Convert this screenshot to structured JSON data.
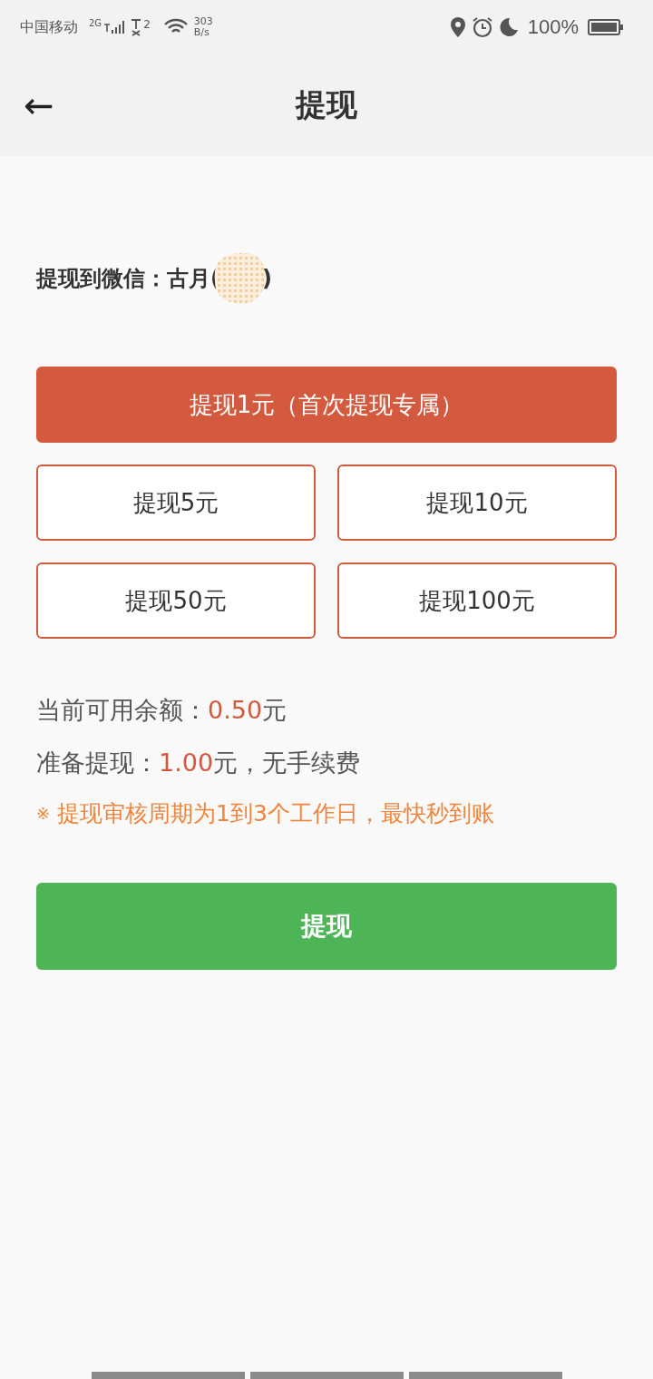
{
  "status_bar": {
    "carrier": "中国移动",
    "network": "2G",
    "sim2": "2",
    "speed_value": "303",
    "speed_unit": "B/s",
    "battery": "100%"
  },
  "header": {
    "back": "←",
    "title": "提现"
  },
  "account": {
    "label": "提现到微信：古月(",
    "name_end": ")"
  },
  "featured_option": {
    "label": "提现1元（首次提现专属）",
    "selected": true
  },
  "options": [
    {
      "label": "提现5元",
      "selected": false
    },
    {
      "label": "提现10元",
      "selected": false
    },
    {
      "label": "提现50元",
      "selected": false
    },
    {
      "label": "提现100元",
      "selected": false
    }
  ],
  "balance": {
    "label": "当前可用余额：",
    "amount": "0.50",
    "unit": "元"
  },
  "pending": {
    "label": "准备提现：",
    "amount": "1.00",
    "rest": "元，无手续费"
  },
  "notice": {
    "mark": "※",
    "text": "提现审核周期为1到3个工作日，最快秒到账"
  },
  "submit": {
    "label": "提现"
  }
}
